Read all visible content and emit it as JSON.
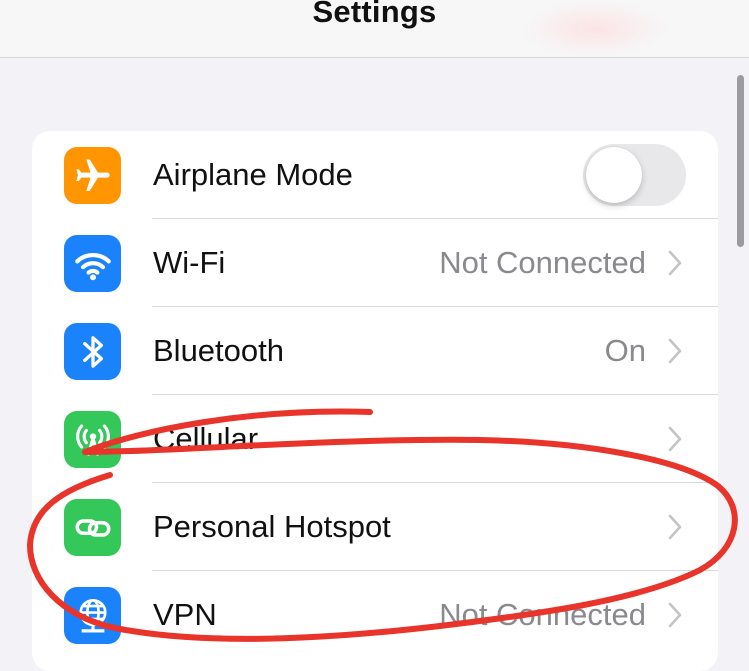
{
  "header": {
    "title": "Settings"
  },
  "rows": [
    {
      "label": "Airplane Mode",
      "icon": "airplane-icon",
      "color": "#ff9500",
      "toggle_on": false
    },
    {
      "label": "Wi-Fi",
      "value": "Not Connected",
      "icon": "wifi-icon",
      "color": "#1a82fb"
    },
    {
      "label": "Bluetooth",
      "value": "On",
      "icon": "bluetooth-icon",
      "color": "#1a82fb"
    },
    {
      "label": "Cellular",
      "icon": "cellular-antenna-icon",
      "color": "#34c759"
    },
    {
      "label": "Personal Hotspot",
      "icon": "hotspot-link-icon",
      "color": "#34c759"
    },
    {
      "label": "VPN",
      "value": "Not Connected",
      "icon": "globe-vpn-icon",
      "color": "#1a82fb"
    }
  ],
  "annotation": {
    "shape": "hand-drawn-ellipse",
    "color": "#e8342b"
  }
}
